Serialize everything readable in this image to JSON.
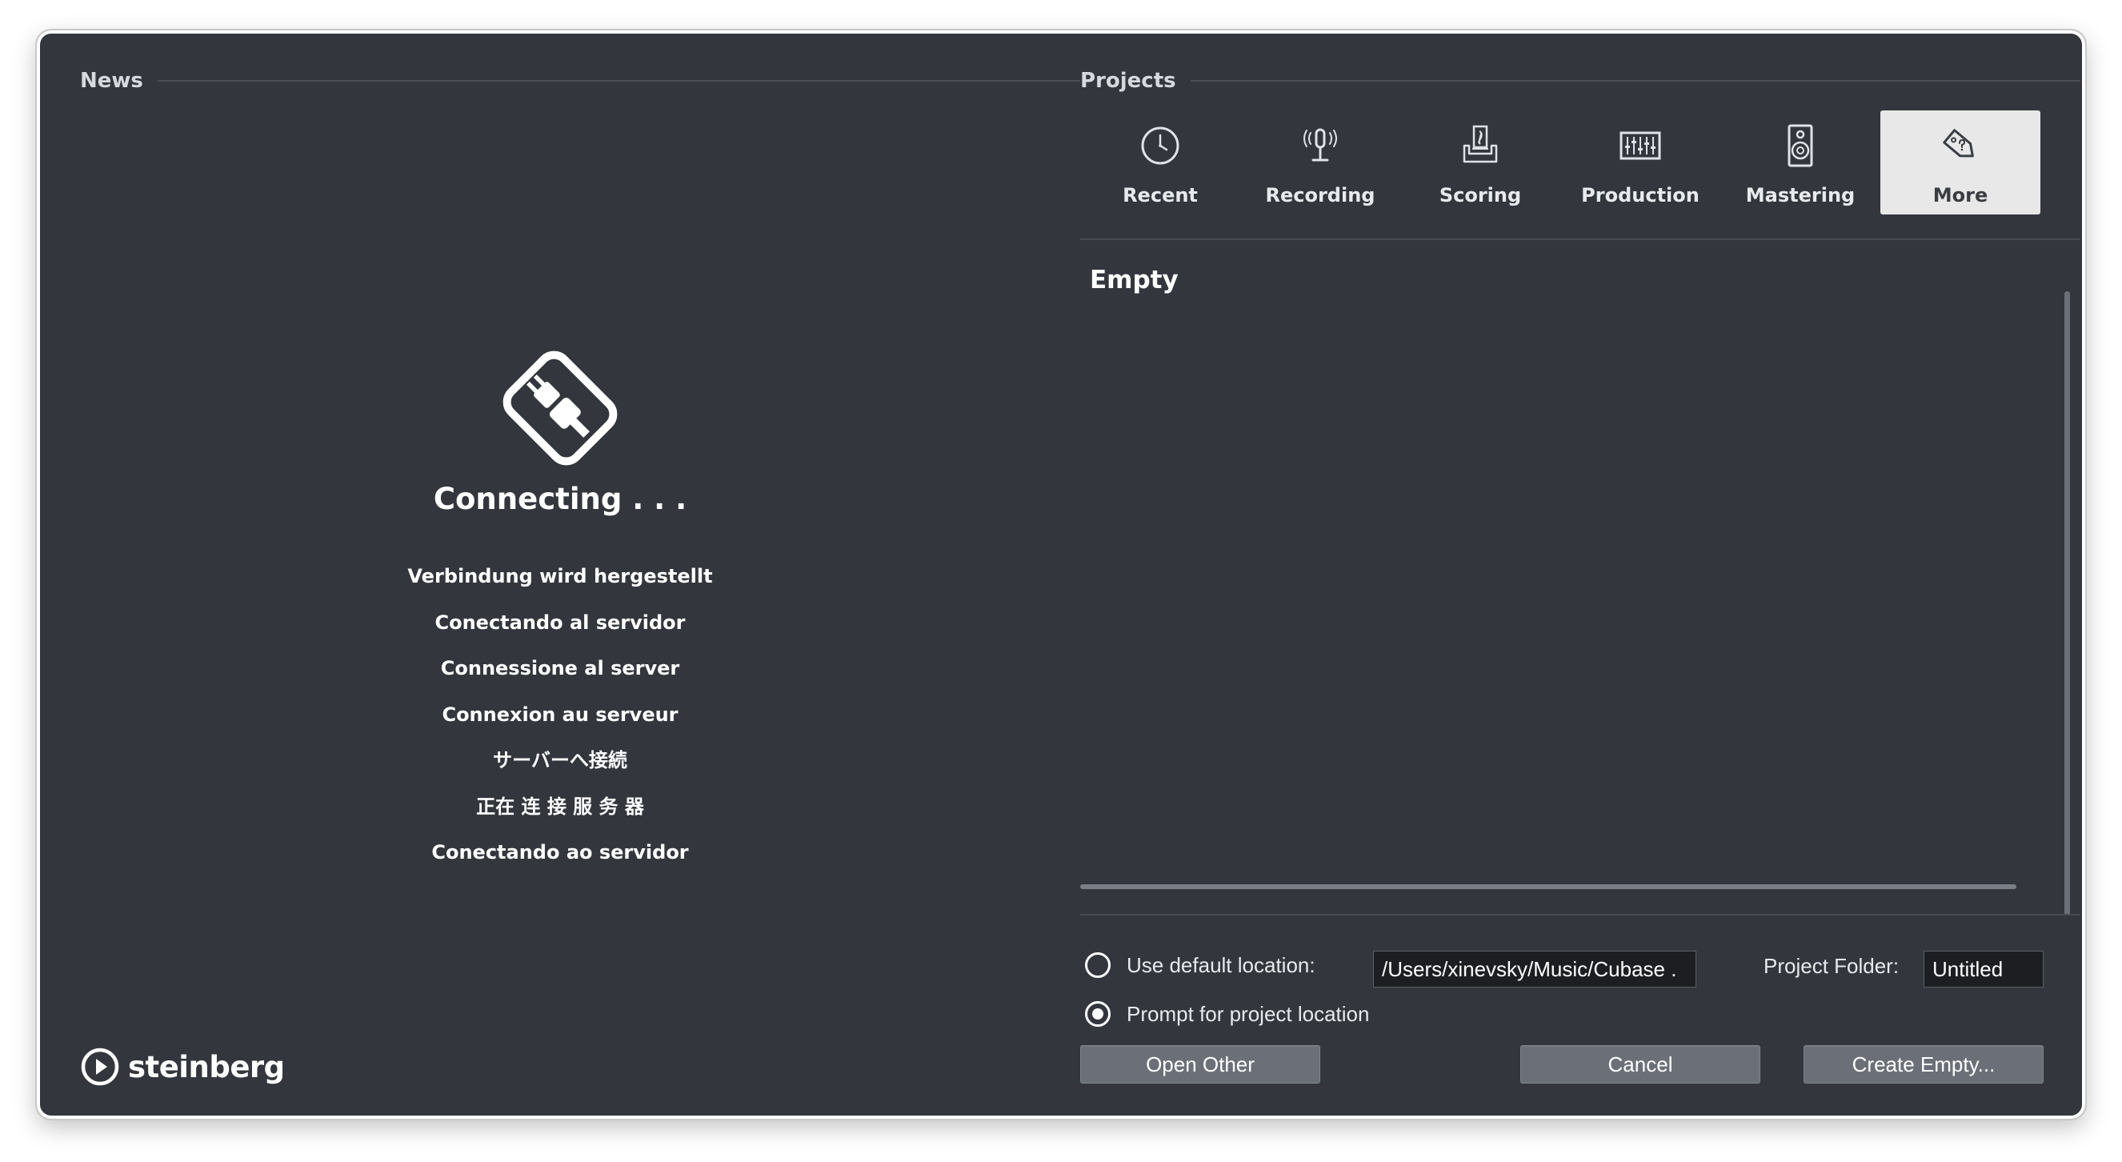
{
  "news": {
    "title": "News",
    "status_title": "Connecting  . . .",
    "status_translations": [
      "Verbindung wird hergestellt",
      "Conectando al servidor",
      "Connessione al server",
      "Connexion au serveur",
      "サーバーへ接続",
      "正在 连 接 服 务 器",
      "Conectando ao servidor"
    ],
    "logo_text": "steinberg"
  },
  "projects": {
    "title": "Projects",
    "tabs": [
      {
        "label": "Recent",
        "icon": "clock-icon"
      },
      {
        "label": "Recording",
        "icon": "microphone-icon"
      },
      {
        "label": "Scoring",
        "icon": "score-icon"
      },
      {
        "label": "Production",
        "icon": "mixer-icon"
      },
      {
        "label": "Mastering",
        "icon": "speaker-icon"
      },
      {
        "label": "More",
        "icon": "tag-icon"
      }
    ],
    "active_tab": "More",
    "list_items": [
      "Empty"
    ]
  },
  "location": {
    "default_label": "Use default location:",
    "default_path": "/Users/xinevsky/Music/Cubase .",
    "prompt_label": "Prompt for project location",
    "selected": "prompt",
    "folder_label": "Project Folder:",
    "folder_value": "Untitled"
  },
  "buttons": {
    "open_other": "Open Other",
    "cancel": "Cancel",
    "create_empty": "Create Empty..."
  },
  "colors": {
    "background": "#33373d",
    "active_tab": "#e8e8e8",
    "button": "#6b7078"
  }
}
